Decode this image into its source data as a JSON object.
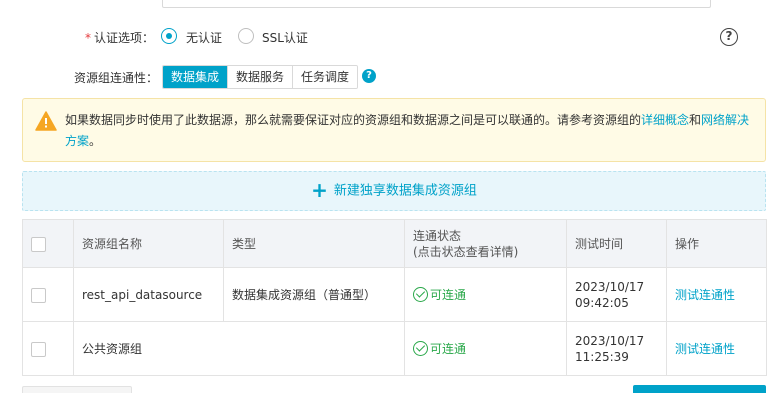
{
  "auth": {
    "required_mark": "*",
    "label": "认证选项：",
    "options": [
      {
        "label": "无认证",
        "checked": true
      },
      {
        "label": "SSL认证",
        "checked": false
      }
    ],
    "help_icon": "question-circle-icon"
  },
  "connectivity": {
    "label": "资源组连通性：",
    "tabs": [
      "数据集成",
      "数据服务",
      "任务调度"
    ],
    "active_tab": "数据集成",
    "badge": "?"
  },
  "notice": {
    "icon": "warning-icon",
    "text_before": "如果数据同步时使用了此数据源，那么就需要保证对应的资源组和数据源之间是可以联通的。请参考资源组的",
    "link1": "详细概念",
    "conj": "和",
    "link2": "网络解决方案",
    "text_after": "。"
  },
  "create": {
    "plus": "+",
    "label": "新建独享数据集成资源组"
  },
  "table": {
    "headers": {
      "name": "资源组名称",
      "type": "类型",
      "status_line1": "连通状态",
      "status_line2": "(点击状态查看详情)",
      "time": "测试时间",
      "op": "操作"
    },
    "rows": [
      {
        "name": "rest_api_datasource",
        "type": "数据集成资源组（普通型）",
        "status": "可连通",
        "date": "2023/10/17",
        "time": "09:42:05",
        "op": "测试连通性"
      },
      {
        "name": "公共资源组",
        "type": "",
        "status": "可连通",
        "date": "2023/10/17",
        "time": "11:25:39",
        "op": "测试连通性"
      }
    ]
  },
  "colors": {
    "accent": "#00a2c9",
    "success": "#2aa84a",
    "warning": "#f5a623",
    "notice_bg": "#fffbe6"
  }
}
